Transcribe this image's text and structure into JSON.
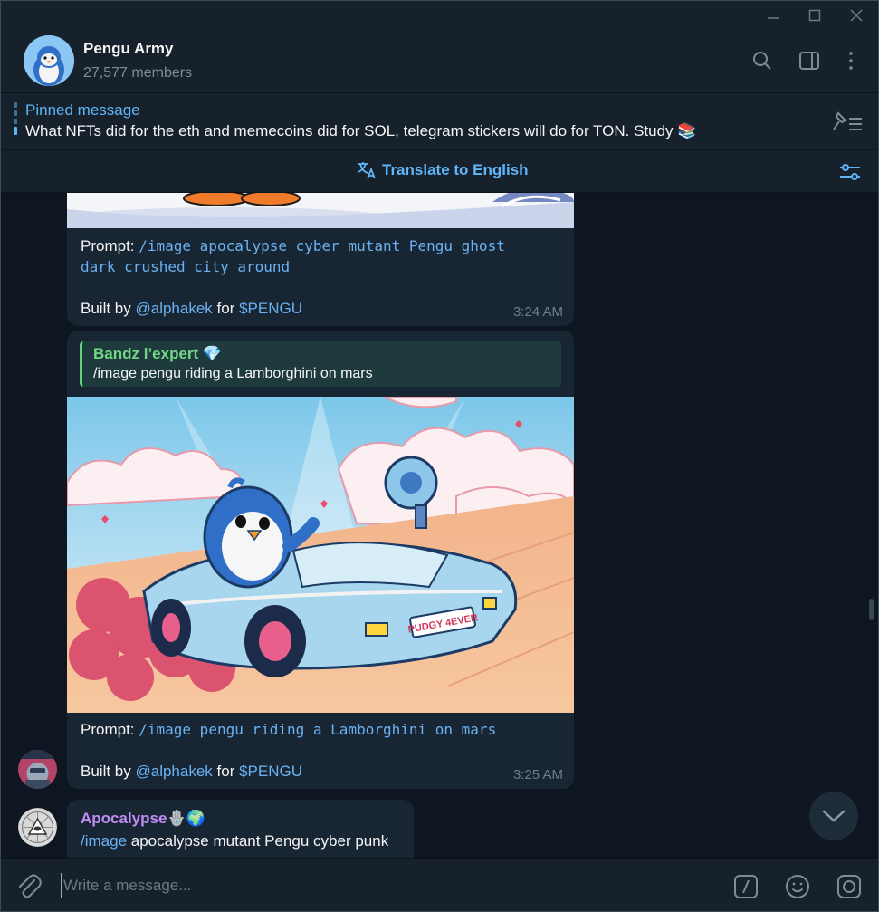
{
  "window": {
    "minimize_icon": "minimize-icon",
    "maximize_icon": "maximize-icon",
    "close_icon": "close-icon"
  },
  "header": {
    "title": "Pengu Army",
    "subtitle": "27,577 members",
    "icons": [
      "search-icon",
      "sidebar-toggle-icon",
      "more-vert-icon"
    ]
  },
  "pinned": {
    "title": "Pinned message",
    "text": "What NFTs did for the eth and memecoins did for SOL, telegram stickers will do for TON.  Study 📚"
  },
  "translate": {
    "label": "Translate to English"
  },
  "messages": [
    {
      "prompt_label": "Prompt: ",
      "prompt_line1": "/image apocalypse cyber mutant Pengu ghost",
      "prompt_line2": "dark crushed city around",
      "built_by": "Built by ",
      "built_handle": "@alphakek",
      "built_for": " for ",
      "built_ticker": "$PENGU",
      "time": "3:24 AM"
    },
    {
      "reply_name": "Bandz l’expert 💎",
      "reply_text": "/image pengu riding a Lamborghini on mars",
      "image_caption": "PUDGY 4EVER",
      "prompt_label": "Prompt: ",
      "prompt_line1": "/image pengu riding a Lamborghini on mars",
      "built_by": "Built by ",
      "built_handle": "@alphakek",
      "built_for": " for ",
      "built_ticker": "$PENGU",
      "time": "3:25 AM"
    },
    {
      "sender": "Apocalypse",
      "sender_emoji": "🪬🌍",
      "command": "/image",
      "text": " apocalypse  mutant Pengu cyber punk"
    }
  ],
  "composer": {
    "placeholder": "Write a message...",
    "icons": [
      "attach-icon",
      "bot-command-icon",
      "emoji-icon",
      "camera-icon"
    ]
  },
  "colors": {
    "accent": "#5eb5f7",
    "bubble": "#182533",
    "background": "#0e1621",
    "panel": "#17212b",
    "reply_name": "#72d886",
    "sender_name": "#c08df5"
  }
}
